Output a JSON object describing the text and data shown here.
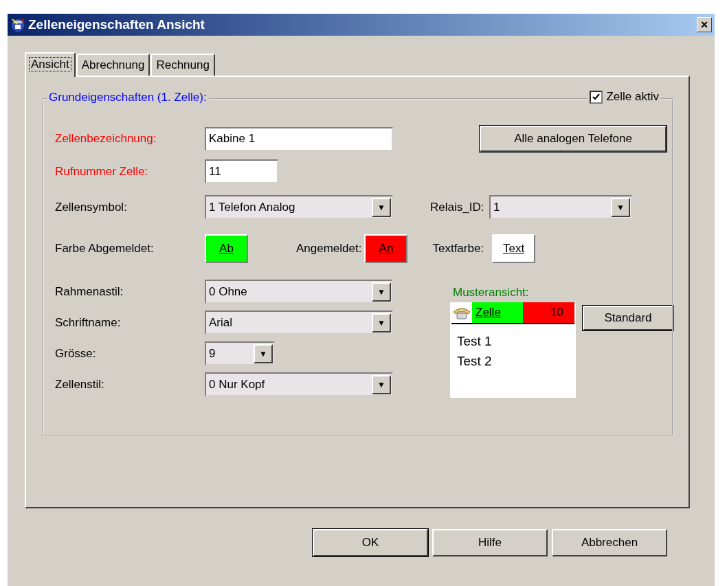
{
  "window": {
    "title": "Zelleneigenschaften Ansicht",
    "close": "×"
  },
  "tabs": [
    {
      "label": "Ansicht",
      "selected": true
    },
    {
      "label": "Abrechnung",
      "selected": false
    },
    {
      "label": "Rechnung",
      "selected": false
    }
  ],
  "group": {
    "legend": "Grundeigenschaften (1. Zelle):",
    "active": {
      "label": "Zelle aktiv",
      "checked": true
    }
  },
  "name_field": {
    "label": "Zellenbezeichnung:",
    "required": true,
    "value": "Kabine 1"
  },
  "number_field": {
    "label": "Rufnummer Zelle:",
    "required": true,
    "value": "11"
  },
  "all_phones_button": "Alle analogen Telefone",
  "symbol": {
    "label": "Zellensymbol:",
    "value": "1 Telefon Analog",
    "arrow": "▼"
  },
  "relay": {
    "label": "Relais_ID:",
    "value": "1",
    "arrow": "▼"
  },
  "colors": [
    {
      "label": "Farbe Abgemeldet:",
      "button": "Ab",
      "color": "#00ff00"
    },
    {
      "label": "Angemeldet:",
      "button": "An",
      "color": "#ff0000"
    },
    {
      "label": "Textfarbe:",
      "button": "Text",
      "color": "#ffffff"
    }
  ],
  "dropdowns": [
    {
      "label": "Rahmenastil:",
      "value": "0 Ohne",
      "arrow": "▼",
      "kind": "wide"
    },
    {
      "label": "Schriftname:",
      "value": "Arial",
      "arrow": "▼",
      "kind": "wide"
    },
    {
      "label": "Grösse:",
      "value": "9",
      "arrow": "▼",
      "kind": "narrow"
    },
    {
      "label": "Zellenstil:",
      "value": "0 Nur Kopf",
      "arrow": "▼",
      "kind": "wide"
    }
  ],
  "preview": {
    "label": "Musteransicht:",
    "cell_name": "Zelle",
    "cell_number": "10",
    "lines": [
      "Test 1",
      "Test 2"
    ],
    "standard_button": "Standard"
  },
  "buttons": [
    {
      "label": "OK",
      "default": true
    },
    {
      "label": "Hilfe",
      "default": false
    },
    {
      "label": "Abbrechen",
      "default": false
    }
  ]
}
